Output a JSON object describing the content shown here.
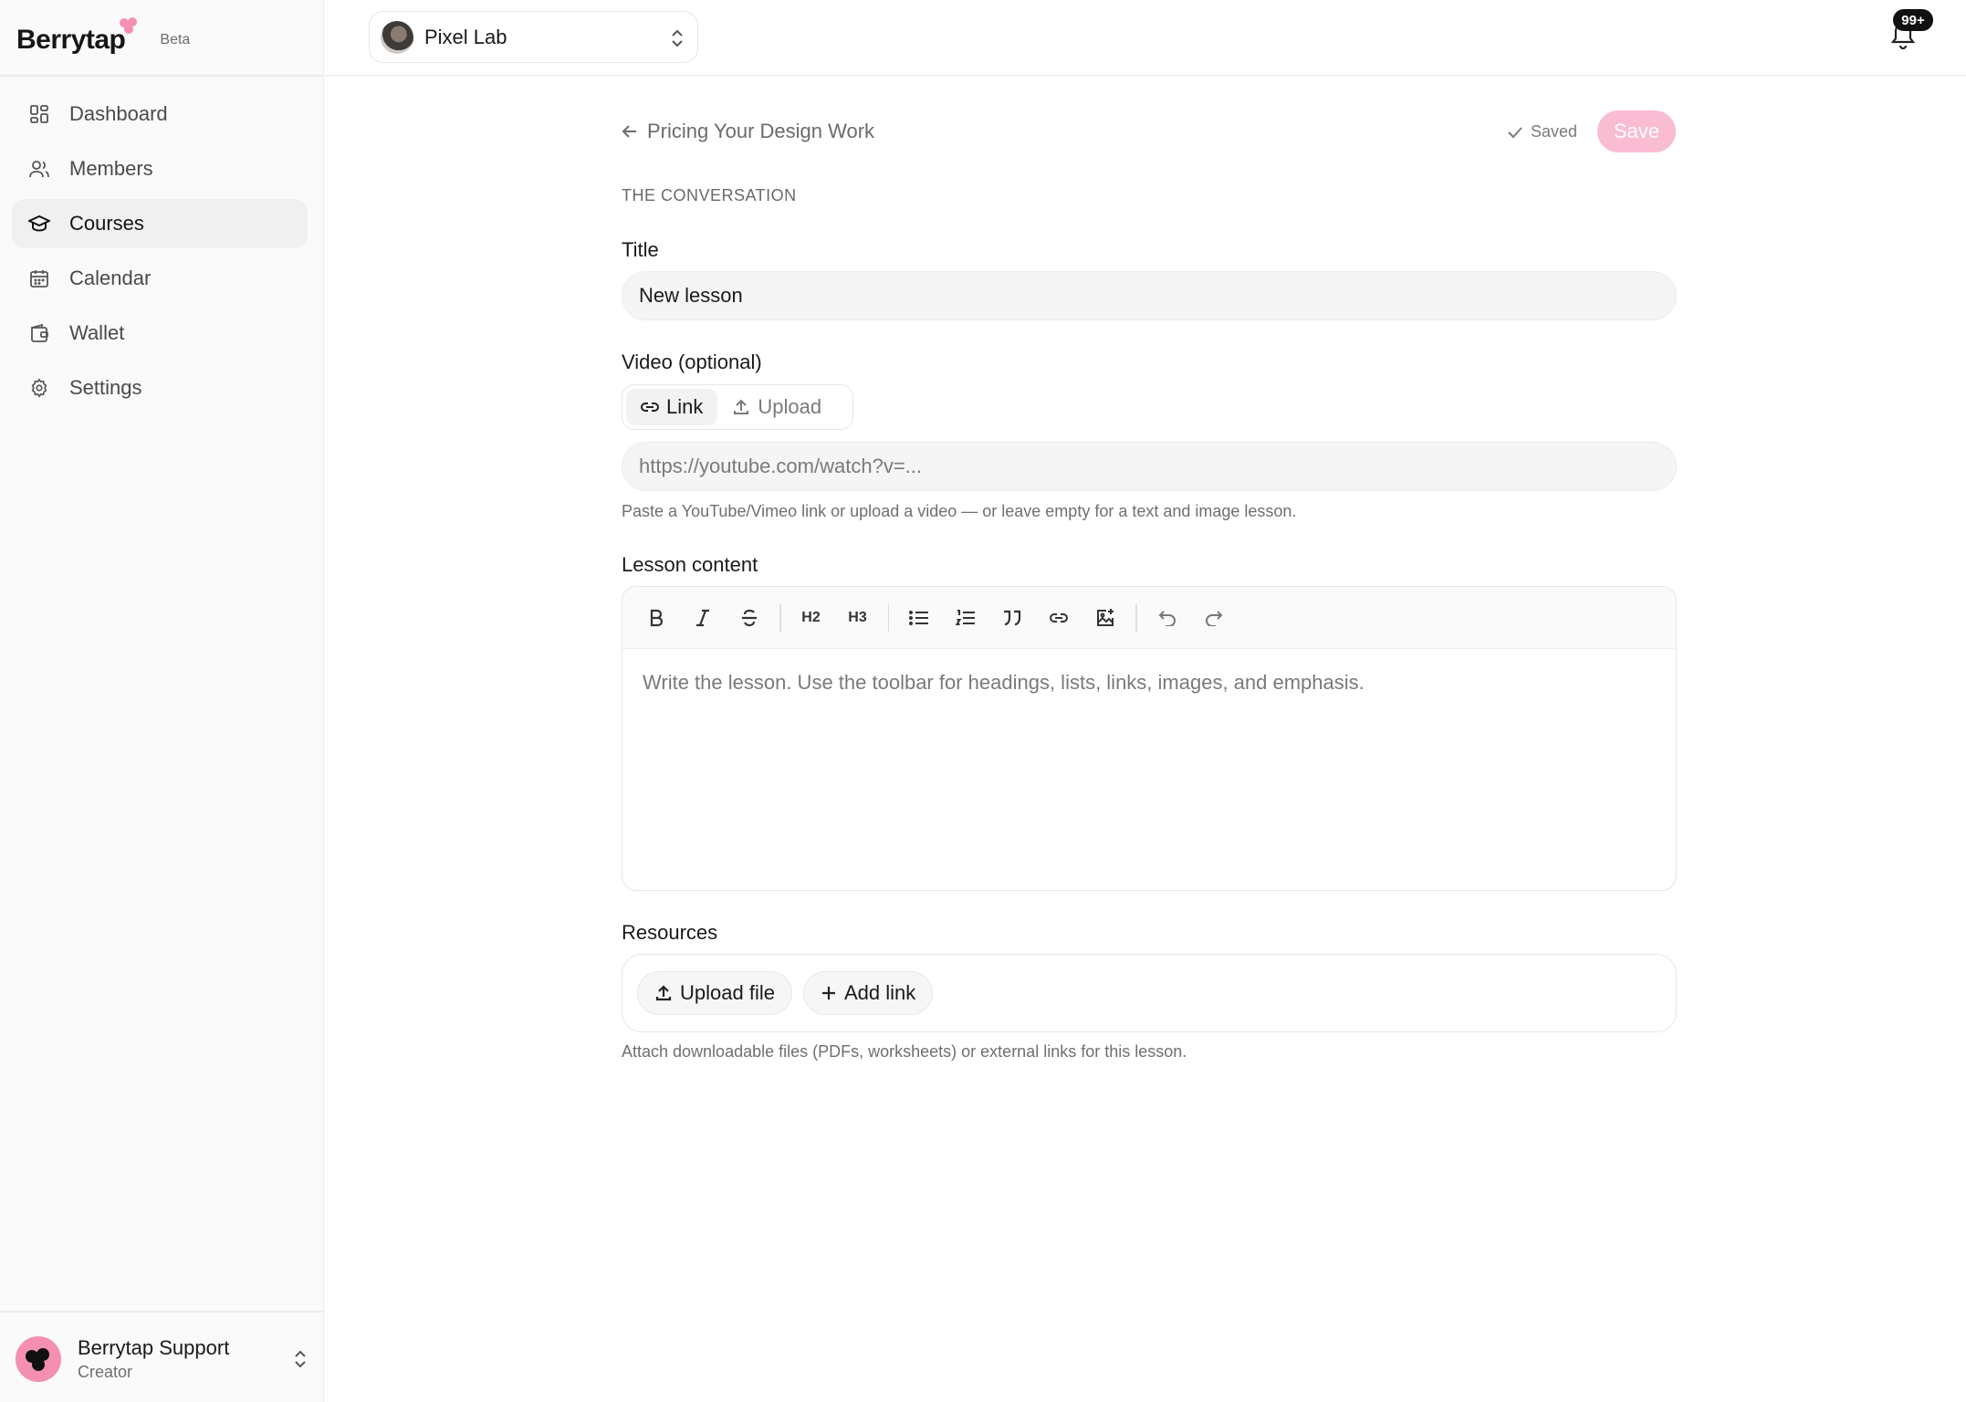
{
  "brand": {
    "name": "Berrytap",
    "beta": "Beta",
    "accent": "#f48fb1"
  },
  "sidebar": {
    "items": [
      {
        "label": "Dashboard",
        "icon": "dashboard-grid-icon"
      },
      {
        "label": "Members",
        "icon": "users-icon"
      },
      {
        "label": "Courses",
        "icon": "graduation-cap-icon",
        "active": true
      },
      {
        "label": "Calendar",
        "icon": "calendar-icon"
      },
      {
        "label": "Wallet",
        "icon": "wallet-icon"
      },
      {
        "label": "Settings",
        "icon": "gear-icon"
      }
    ],
    "user": {
      "name": "Berrytap Support",
      "role": "Creator"
    }
  },
  "header": {
    "workspace": "Pixel Lab",
    "notifications": "99+"
  },
  "editor": {
    "back_label": "Pricing Your Design Work",
    "saved_label": "Saved",
    "save_label": "Save",
    "section": "THE CONVERSATION",
    "title_label": "Title",
    "title_value": "New lesson",
    "video_label": "Video (optional)",
    "video_tabs": {
      "link": "Link",
      "upload": "Upload"
    },
    "video_placeholder": "https://youtube.com/watch?v=...",
    "video_help": "Paste a YouTube/Vimeo link or upload a video — or leave empty for a text and image lesson.",
    "content_label": "Lesson content",
    "toolbar": {
      "h2": "H2",
      "h3": "H3"
    },
    "content_placeholder": "Write the lesson. Use the toolbar for headings, lists, links, images, and emphasis.",
    "resources_label": "Resources",
    "upload_file_label": "Upload file",
    "add_link_label": "Add link",
    "resources_help": "Attach downloadable files (PDFs, worksheets) or external links for this lesson.",
    "save_color": "#f9bcd2"
  }
}
